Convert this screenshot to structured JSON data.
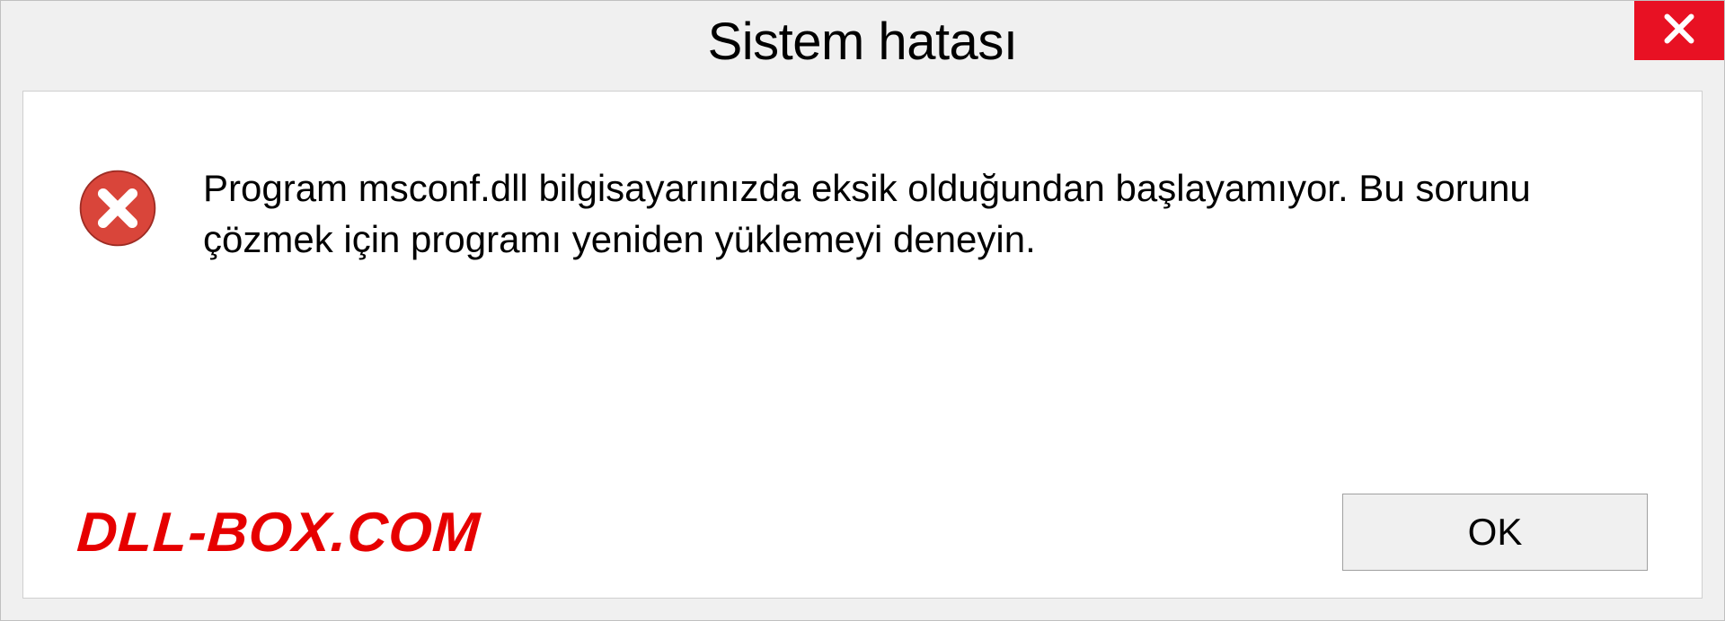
{
  "dialog": {
    "title": "Sistem hatası",
    "message": "Program msconf.dll bilgisayarınızda eksik olduğundan başlayamıyor. Bu sorunu çözmek için programı yeniden yüklemeyi deneyin.",
    "ok_label": "OK"
  },
  "watermark": "DLL-BOX.COM"
}
